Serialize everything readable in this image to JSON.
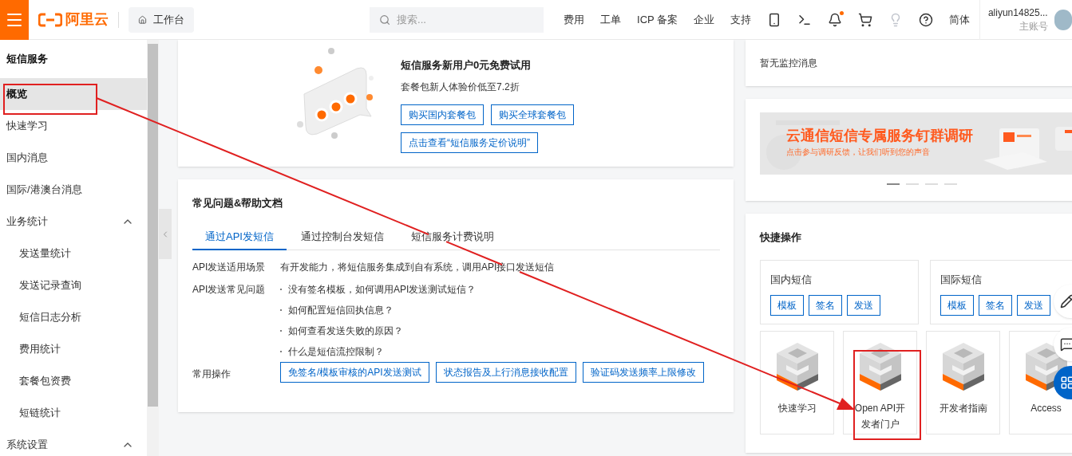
{
  "header": {
    "logo_text": "阿里云",
    "workbench": "工作台",
    "search": {
      "placeholder": "搜索..."
    },
    "nav_links": [
      "费用",
      "工单",
      "ICP 备案",
      "企业",
      "支持"
    ],
    "icons": [
      {
        "kind": "api"
      },
      {
        "kind": "terminal"
      },
      {
        "kind": "bell",
        "unread": true
      },
      {
        "kind": "cart"
      },
      {
        "kind": "bulb"
      },
      {
        "kind": "help"
      }
    ],
    "language": "简体",
    "user": {
      "name": "aliyun14825...",
      "role": "主账号"
    }
  },
  "sidebar": {
    "title": "短信服务",
    "items": [
      {
        "label": "概览",
        "selected": true,
        "annotated": true
      },
      {
        "label": "快速学习",
        "selected": false
      },
      {
        "label": "国内消息",
        "selected": false
      },
      {
        "label": "国际/港澳台消息",
        "selected": false
      },
      {
        "label": "业务统计",
        "selected": false,
        "expanded": true,
        "children": [
          {
            "label": "发送量统计",
            "selected": false
          },
          {
            "label": "发送记录查询",
            "selected": false
          },
          {
            "label": "短信日志分析",
            "selected": false
          },
          {
            "label": "费用统计",
            "selected": false
          },
          {
            "label": "套餐包资费",
            "selected": false
          },
          {
            "label": "短链统计",
            "selected": false
          }
        ]
      },
      {
        "label": "系统设置",
        "selected": false,
        "expanded": true
      }
    ]
  },
  "promo": {
    "title": "短信服务新用户0元免费试用",
    "subtitle": "套餐包新人体验价低至7.2折",
    "buttons": [
      "购买国内套餐包",
      "购买全球套餐包",
      "点击查看“短信服务定价说明”"
    ]
  },
  "help": {
    "title": "常见问题&帮助文档",
    "tabs": [
      {
        "label": "通过API发短信",
        "selected": true
      },
      {
        "label": "通过控制台发短信",
        "selected": false
      },
      {
        "label": "短信服务计费说明",
        "selected": false
      }
    ],
    "rows": [
      {
        "kind": "text",
        "label": "API发送适用场景",
        "text": "有开发能力，将短信服务集成到自有系统，调用API接口发送短信"
      },
      {
        "kind": "list",
        "label": "API发送常见问题",
        "items": [
          "没有签名模板，如何调用API发送测试短信？",
          "如何配置短信回执信息？",
          "如何查看发送失败的原因？",
          "什么是短信流控限制？"
        ]
      },
      {
        "kind": "buttons",
        "label": "常用操作",
        "buttons": [
          "免签名/模板审核的API发送测试",
          "状态报告及上行消息接收配置",
          "验证码发送频率上限修改"
        ]
      }
    ]
  },
  "monitor": {
    "message": "暂无监控消息"
  },
  "banner": {
    "title": "云通信短信专属服务钉群调研",
    "subtitle": "点击参与调研反馈，让我们听到您的声音",
    "dots": [
      {
        "selected": true
      },
      {
        "selected": false
      },
      {
        "selected": false
      },
      {
        "selected": false
      }
    ]
  },
  "quick": {
    "title": "快捷操作",
    "groups": [
      {
        "title": "国内短信",
        "buttons": [
          "模板",
          "签名",
          "发送"
        ]
      },
      {
        "title": "国际短信",
        "buttons": [
          "模板",
          "签名",
          "发送"
        ]
      }
    ],
    "tiles": [
      {
        "label": "快速学习",
        "annotated": false
      },
      {
        "label": "Open API开发者门户",
        "annotated": true
      },
      {
        "label": "开发者指南",
        "annotated": false
      },
      {
        "label": "Access",
        "annotated": false
      }
    ]
  }
}
